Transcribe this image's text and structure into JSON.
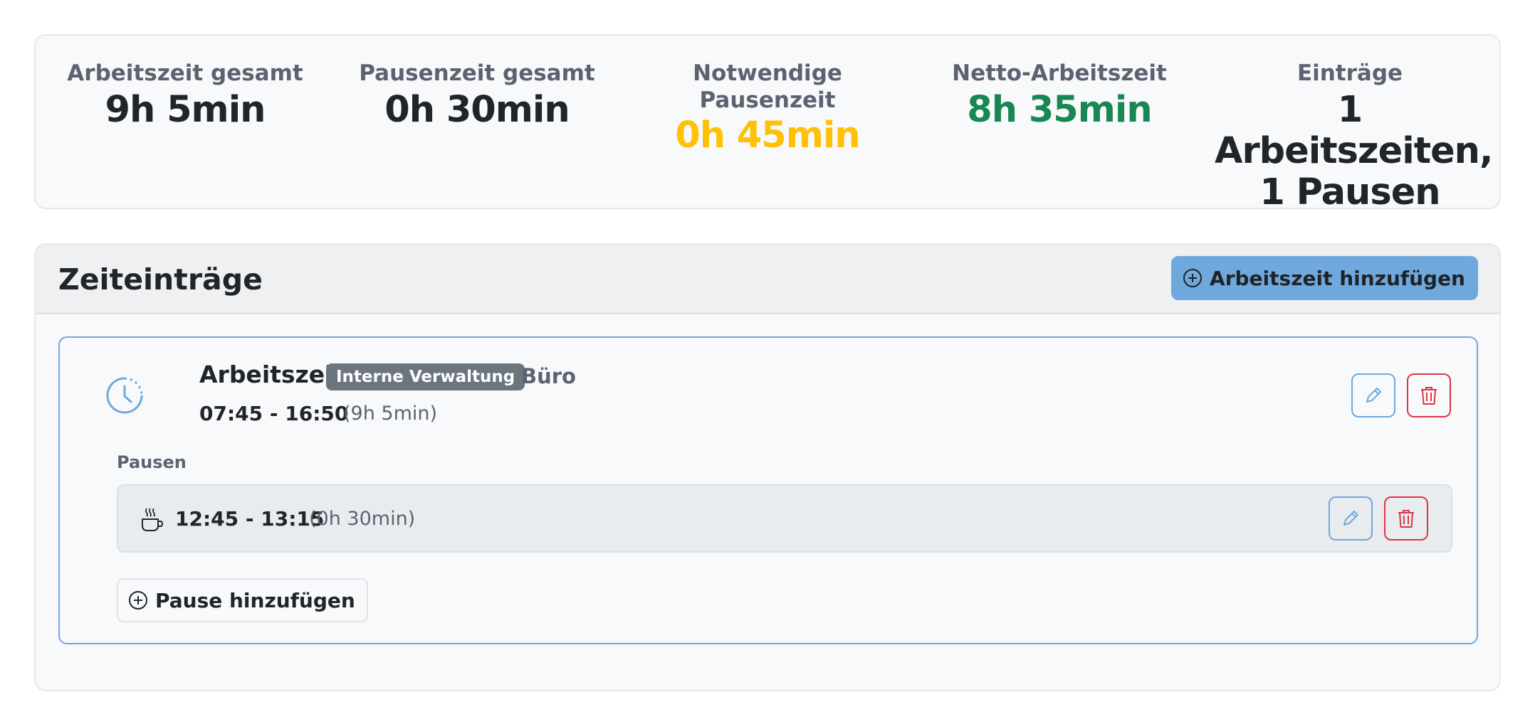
{
  "summary": {
    "stats": [
      {
        "label": "Arbeitszeit gesamt",
        "value": "9h 5min"
      },
      {
        "label": "Pausenzeit gesamt",
        "value": "0h 30min"
      },
      {
        "label_line1": "Notwendige",
        "label_line2": "Pausenzeit",
        "value": "0h 45min",
        "color": "#ffc107"
      },
      {
        "label": "Netto-Arbeitszeit",
        "value": "8h 35min",
        "color": "#198754"
      },
      {
        "label": "Einträge",
        "value_line1": "1 Arbeitszeiten,",
        "value_line2": "1 Pausen"
      }
    ]
  },
  "entries": {
    "title": "Zeiteinträge",
    "add_work_label": "Arbeitszeit hinzufügen",
    "add_icon": "circle-plus-icon",
    "items": [
      {
        "type": "Arbeitszeit",
        "badge": "Interne Verwaltung",
        "location": "Büro",
        "time_range": "07:45 - 16:50",
        "duration": "(9h 5min)",
        "icon": "clock-icon",
        "breaks_label": "Pausen",
        "breaks": [
          {
            "time_range": "12:45 - 13:15",
            "duration": "(0h 30min)",
            "icon": "coffee-cup-icon"
          }
        ],
        "add_break_label": "Pause hinzufügen"
      }
    ]
  },
  "colors": {
    "primary": "#6ea8dd",
    "danger": "#dc3545",
    "warning": "#ffc107",
    "success": "#198754",
    "badge": "#6c757d"
  }
}
